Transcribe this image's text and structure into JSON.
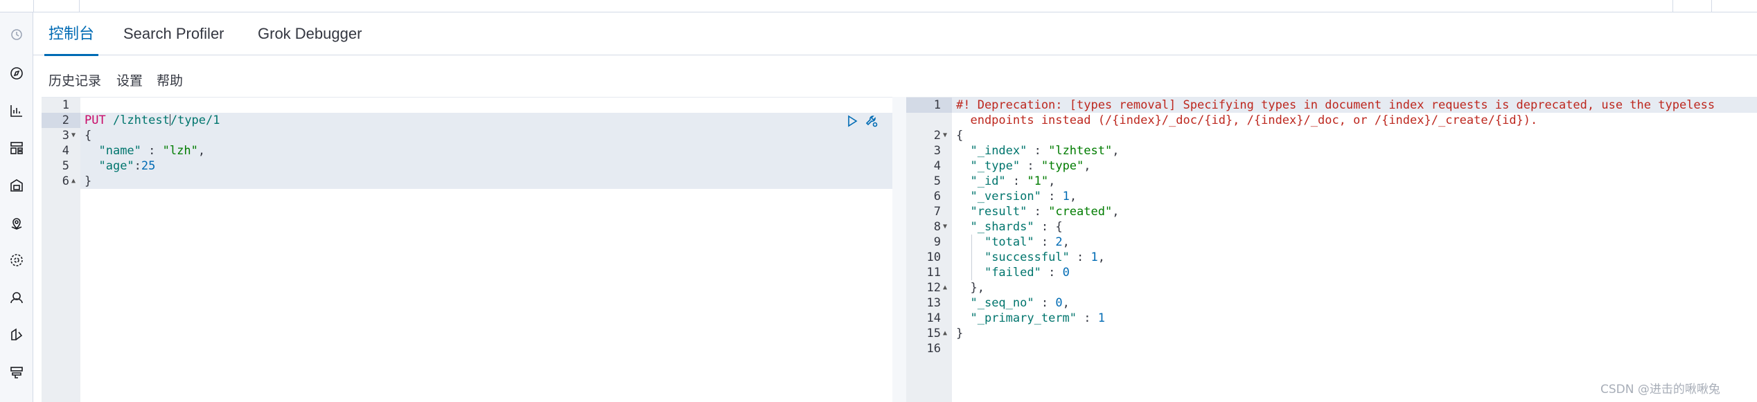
{
  "tabs": [
    {
      "label": "控制台",
      "active": true
    },
    {
      "label": "Search Profiler",
      "active": false
    },
    {
      "label": "Grok Debugger",
      "active": false
    }
  ],
  "toolbar": {
    "history": "历史记录",
    "settings": "设置",
    "help": "帮助"
  },
  "nav_icons": [
    "clock-icon",
    "compass-icon",
    "chart-icon",
    "dashboard-icon",
    "canvas-icon",
    "map-icon",
    "ml-icon",
    "user-monitor-icon",
    "siem-icon",
    "devtools-icon"
  ],
  "request": {
    "method": "PUT",
    "path_before_cursor": " /lzhtest",
    "path_after_cursor": "/type/1",
    "lines": [
      "",
      "",
      "{",
      "  \"name\" : \"lzh\",",
      "  \"age\":25",
      "}"
    ]
  },
  "response": {
    "warning_1": "#! Deprecation: [types removal] Specifying types in document index requests is deprecated, use the typeless",
    "warning_2": "  endpoints instead (/{index}/_doc/{id}, /{index}/_doc, or /{index}/_create/{id}).",
    "index_key": "\"_index\"",
    "index_val": "\"lzhtest\"",
    "type_key": "\"_type\"",
    "type_val": "\"type\"",
    "id_key": "\"_id\"",
    "id_val": "\"1\"",
    "version_key": "\"_version\"",
    "version_val": "1",
    "result_key": "\"result\"",
    "result_val": "\"created\"",
    "shards_key": "\"_shards\"",
    "total_key": "\"total\"",
    "total_val": "2",
    "successful_key": "\"successful\"",
    "successful_val": "1",
    "failed_key": "\"failed\"",
    "failed_val": "0",
    "seq_key": "\"_seq_no\"",
    "seq_val": "0",
    "primary_key": "\"_primary_term\"",
    "primary_val": "1"
  },
  "watermark": "CSDN @进击的啾啾兔"
}
